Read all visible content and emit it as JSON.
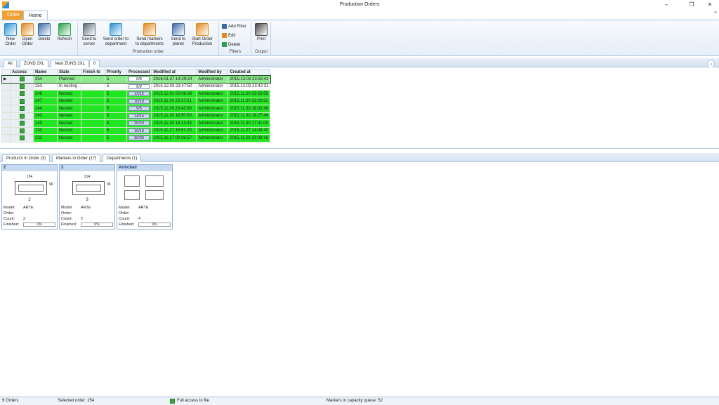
{
  "window": {
    "title": "Production Orders"
  },
  "ribbon_tabs": [
    "Order",
    "Home"
  ],
  "ribbon": {
    "buttons": [
      {
        "label": "New\nOrder",
        "icon": "new-order-icon",
        "color": "#2a8fd6"
      },
      {
        "label": "Open\nOrder",
        "icon": "open-order-icon",
        "color": "#e08a20"
      },
      {
        "label": "Delete",
        "icon": "delete-icon",
        "color": "#3b6aa8"
      },
      {
        "label": "Refresh",
        "icon": "refresh-icon",
        "color": "#2aa04a"
      },
      {
        "label": "Send to\nserver",
        "icon": "send-server-icon",
        "color": "#5a6a7a"
      },
      {
        "label": "Send order to\ndepartment",
        "icon": "send-department-icon",
        "color": "#2a8fd6"
      },
      {
        "label": "Send markers\nto departments",
        "icon": "send-markers-icon",
        "color": "#e08a20"
      },
      {
        "label": "Send to\nplaner",
        "icon": "send-planer-icon",
        "color": "#3b6aa8"
      },
      {
        "label": "Start Order\nProduction",
        "icon": "start-production-icon",
        "color": "#e08a20"
      },
      {
        "label": "Print",
        "icon": "printer-icon",
        "color": "#444444"
      }
    ],
    "filters": [
      "Add Filter",
      "Edit",
      "Delete"
    ],
    "groups": {
      "production": "Production order",
      "filters": "Filters",
      "output": "Output"
    }
  },
  "grid_tabs": [
    "All",
    "ZUND 2XL",
    "Nest ZUND 2XL",
    "0"
  ],
  "orders": {
    "columns": [
      "Access",
      "Name",
      "State",
      "Finish to",
      "Priority",
      "Processed",
      "Modified at",
      "Modified by",
      "Created at"
    ],
    "rows": [
      {
        "name": "254",
        "state": "Planned",
        "finish": "",
        "priority": "5",
        "processed": "0/8",
        "modified_at": "2016.01.27 14:29:24",
        "modified_by": "Administrator",
        "created_at": "2015.12.03 23:56:42",
        "kind": "planned"
      },
      {
        "name": "253",
        "state": "In nesting",
        "finish": "",
        "priority": "5",
        "processed": "0/9",
        "modified_at": "2015.12.03 23:47:50",
        "modified_by": "Administrator",
        "created_at": "2015.12.03 23:42:31",
        "kind": "nesting"
      },
      {
        "name": "248",
        "state": "Nested",
        "finish": "",
        "priority": "5",
        "processed": "12/12",
        "modified_at": "2015.12.01 00:06:38",
        "modified_by": "Administrator",
        "created_at": "2015.11.30 23:53:55",
        "kind": "nested"
      },
      {
        "name": "247",
        "state": "Nested",
        "finish": "",
        "priority": "5",
        "processed": "10/10",
        "modified_at": "2015.11.30 23:37:21",
        "modified_by": "Administrator",
        "created_at": "2015.11.30 23:20:52",
        "kind": "nested"
      },
      {
        "name": "244",
        "state": "Nested",
        "finish": "",
        "priority": "5",
        "processed": "5/5",
        "modified_at": "2015.11.30 23:43:39",
        "modified_by": "Administrator",
        "created_at": "2015.11.30 18:32:48",
        "kind": "nested"
      },
      {
        "name": "243",
        "state": "Nested",
        "finish": "",
        "priority": "5",
        "processed": "14/14",
        "modified_at": "2015.11.30 18:50:50",
        "modified_by": "Administrator",
        "created_at": "2015.11.30 18:27:44",
        "kind": "nested"
      },
      {
        "name": "240",
        "state": "Nested",
        "finish": "",
        "priority": "5",
        "processed": "20/20",
        "modified_at": "2015.11.30 18:13:43",
        "modified_by": "Administrator",
        "created_at": "2015.11.30 17:41:00",
        "kind": "nested"
      },
      {
        "name": "233",
        "state": "Nested",
        "finish": "",
        "priority": "5",
        "processed": "10/10",
        "modified_at": "2015.11.27 15:51:23",
        "modified_by": "Administrator",
        "created_at": "2015.11.27 14:48:40",
        "kind": "nested"
      },
      {
        "name": "232",
        "state": "Nested",
        "finish": "",
        "priority": "5",
        "processed": "30/30",
        "modified_at": "2015.11.27 00:36:57",
        "modified_by": "Administrator",
        "created_at": "2015.11.26 23:39:16",
        "kind": "nested"
      }
    ]
  },
  "lower_tabs": [
    "Products in Order (3)",
    "Markers in Order (17)",
    "Departments (1)"
  ],
  "products": [
    {
      "title": "2",
      "dim_top": "154",
      "dim_side": "96",
      "dim_bottom": "2",
      "model": "ARTE",
      "order": "",
      "count": "2",
      "finished": "0%"
    },
    {
      "title": "3",
      "dim_top": "214",
      "dim_side": "96",
      "dim_bottom": "3",
      "model": "ARTE",
      "order": "",
      "count": "2",
      "finished": "0%"
    },
    {
      "title": "Armchair",
      "dim_top": "",
      "dim_side": "",
      "dim_bottom": "",
      "model": "ARTE",
      "order": "",
      "count": "4",
      "finished": "0%"
    }
  ],
  "product_labels": {
    "model": "Model:",
    "order": "Order:",
    "count": "Count:",
    "finished": "Finished:"
  },
  "status": {
    "orders": "9 Orders",
    "selected": "Selected order: 254",
    "access": "Full access to file",
    "queue": "Markers in capacity queue: 52"
  }
}
